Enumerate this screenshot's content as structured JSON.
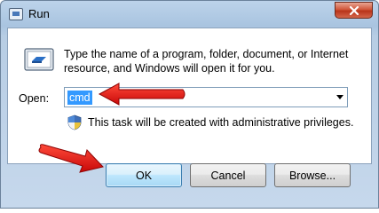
{
  "window": {
    "title": "Run",
    "close_icon": "close-icon",
    "accent_color": "#c9402a"
  },
  "dialog": {
    "prompt": "Type the name of a program, folder, document, or Internet resource, and Windows will open it for you.",
    "open_label": "Open:",
    "open_value": "cmd",
    "admin_note": "This task will be created with administrative privileges.",
    "run_icon": "run-icon",
    "shield_icon": "uac-shield-icon"
  },
  "buttons": {
    "ok": "OK",
    "cancel": "Cancel",
    "browse": "Browse..."
  },
  "annotations": {
    "arrow_color": "#e01010",
    "arrows": [
      "arrow-to-input",
      "arrow-to-ok"
    ]
  }
}
